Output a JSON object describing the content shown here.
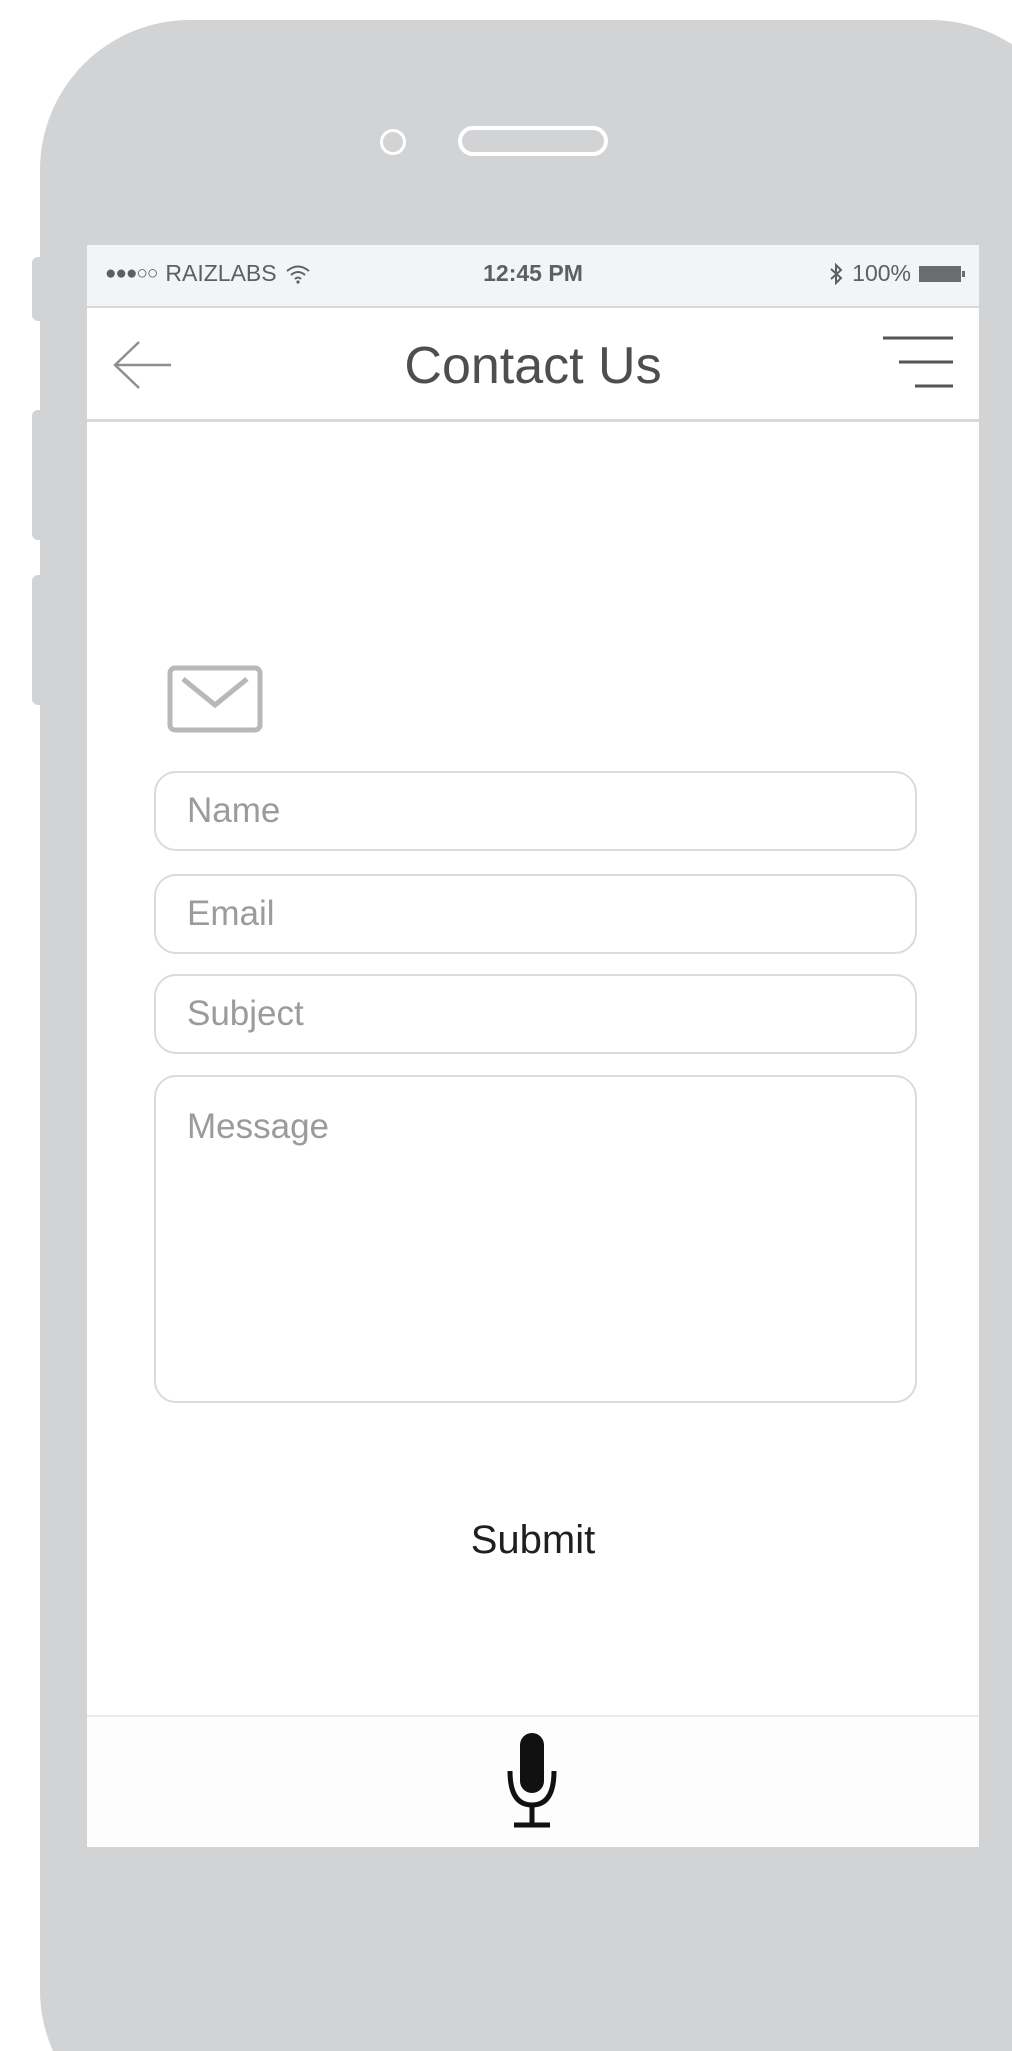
{
  "status_bar": {
    "signal": "●●●○○",
    "carrier": "RAIZLABS",
    "time": "12:45 PM",
    "battery_percent": "100%"
  },
  "nav": {
    "title": "Contact Us"
  },
  "form": {
    "name_placeholder": "Name",
    "email_placeholder": "Email",
    "subject_placeholder": "Subject",
    "message_placeholder": "Message",
    "submit_label": "Submit"
  },
  "icons": {
    "back": "arrow-left-icon",
    "menu": "menu-icon",
    "mail": "envelope-icon",
    "mic": "microphone-icon",
    "wifi": "wifi-icon",
    "bluetooth": "bluetooth-icon",
    "battery": "battery-icon"
  },
  "colors": {
    "phone_frame": "#d2d3d5",
    "status_bar_bg": "#f3f4f5",
    "title_text": "#4d4e50",
    "field_border": "#dadbdc",
    "placeholder": "#9a9b9d"
  }
}
